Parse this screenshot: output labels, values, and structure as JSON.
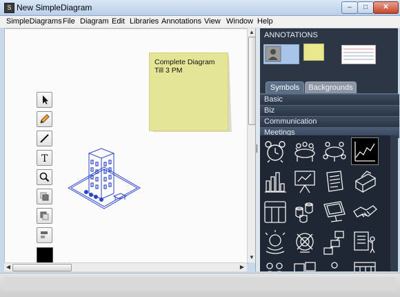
{
  "window": {
    "title": "New SimpleDiagram",
    "app_icon": "S",
    "controls": {
      "minimize": "–",
      "maximize": "□",
      "close": "✕"
    }
  },
  "menu": [
    "SimpleDiagrams",
    "File",
    "Diagram",
    "Edit",
    "Libraries",
    "Annotations",
    "View",
    "Window",
    "Help"
  ],
  "canvas": {
    "sticky_note_text": "Complete Diagram Till 3 PM"
  },
  "tools": [
    {
      "name": "select",
      "icon": "arrow-pointer-icon"
    },
    {
      "name": "pencil",
      "icon": "pencil-icon"
    },
    {
      "name": "line",
      "icon": "line-icon"
    },
    {
      "name": "text",
      "icon": "text-icon",
      "glyph": "T"
    },
    {
      "name": "zoom",
      "icon": "magnifier-icon"
    },
    {
      "name": "bring-forward",
      "icon": "layers-icon"
    },
    {
      "name": "send-backward",
      "icon": "layers-back-icon"
    },
    {
      "name": "align",
      "icon": "align-icon"
    }
  ],
  "color_swatch": "#000000",
  "right_panel": {
    "annotations_header": "ANNOTATIONS",
    "tabs": [
      "Symbols",
      "Backgrounds"
    ],
    "active_tab": "Symbols",
    "categories": [
      "Basic",
      "Biz",
      "Communication",
      "Meetings"
    ]
  },
  "symbols": [
    "alarm-clock-icon",
    "meeting-table-icon",
    "round-table-icon",
    "line-chart-icon",
    "bar-chart-icon",
    "presentation-board-icon",
    "documents-icon",
    "printer-icon",
    "calendar-board-icon",
    "coffee-cups-icon",
    "monitor-icon",
    "handshake-icon",
    "brainstorm-icon",
    "target-icon",
    "flowchart-icon",
    "checklist-icon",
    "people-icon",
    "screens-icon",
    "conference-icon",
    "calendar-icon"
  ]
}
